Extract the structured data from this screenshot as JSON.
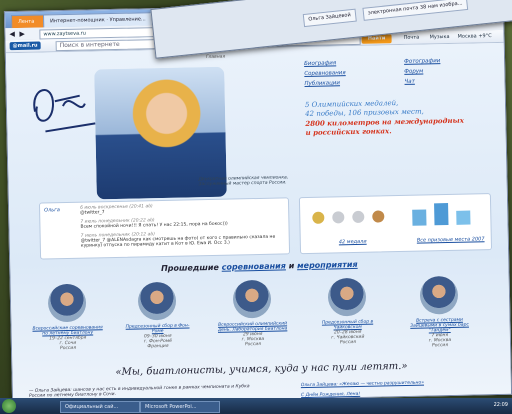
{
  "browser": {
    "tabs": [
      "Лента",
      "Интернет-помощник · Управление...",
      "Ольга Зайцевой",
      "электронная почта 38 нам изобра..."
    ],
    "address": "www.zaytseva.ru",
    "search_placeholder": "Поиск в интернете",
    "brand": "@mail.ru",
    "find_label": "Найти",
    "toolbar_items": [
      "Почта",
      "Музыка",
      "Москва +9°C"
    ]
  },
  "site": {
    "breadcrumb": "Главная",
    "signature": "Olga",
    "nav": [
      "Биография",
      "Фотографии",
      "Соревнования",
      "Форум",
      "Публикации",
      "Чат"
    ],
    "stats": [
      "5 Олимпийских медалей,",
      "42 победы, 106 призовых мест,",
      "2800 километров на международных",
      "и российских гонках."
    ],
    "photo_caption": "Двукратная олимпийская чемпионка, Заслуженный мастер спорта России.",
    "news_label": "Ольга",
    "news": [
      {
        "date": "6 июль воскресенье (20:41 ab)",
        "text": "@twitter_7"
      },
      {
        "date": "7 июль понедельник (20:22 ab)",
        "text": "Всем спокойной ночи!!! Я спать! У нас 22:15, пора на бокос)))"
      },
      {
        "date": "7 июль понедельник (20:12 ab)",
        "text": "@twitter_7 @ALENAsdagra как смотрешь на фото) от кого с правильно сказала не куринку) отпуска по пирамиду катит в Кот в Ю. Ewa И. Осс 3.)"
      }
    ],
    "medals_links": [
      "42 медали",
      "Все призовые места 2007"
    ],
    "events_heading": [
      "Прошедшие",
      "соревнования",
      "и",
      "мероприятия"
    ],
    "events": [
      {
        "title": "Всероссийские соревнования по летнему биатлону",
        "date": "19–22 сентября",
        "place": "г. Сочи",
        "country": "Россия"
      },
      {
        "title": "Предсезонный сбор в Фон-Ромё",
        "date": "09–30 июня",
        "place": "г. Фон-Ромё",
        "country": "Франция"
      },
      {
        "title": "Всероссийский олимпийский день. Лаборатория биатлона",
        "date": "29 июня",
        "place": "г. Москва",
        "country": "Россия"
      },
      {
        "title": "Предсезонный сбор в Чайковском",
        "date": "20–28 июня",
        "place": "г. Чайковский",
        "country": "Россия"
      },
      {
        "title": "Встреча с сестрами Зайцевыми в сумах барс \"Тандем\"",
        "date": "7 июня",
        "place": "г. Москва",
        "country": "Россия"
      }
    ],
    "quote": "«Мы, биатлонисты, учимся, куда у нас пули летят.»",
    "footer_left": "— Ольга Зайцева: шансов у нас есть в индивидуальной гонке в рамках чемпионата и Кубка России по летнему биатлону в Сочи.",
    "footer_right_1": "Ольга Зайцева: «Желаю — честно разрушительно»",
    "footer_right_2": "С Днём Рождения, Лена!"
  },
  "taskbar": {
    "items": [
      "Официальный сай...",
      "Microsoft PowerPoi..."
    ],
    "clock": "22:09"
  }
}
